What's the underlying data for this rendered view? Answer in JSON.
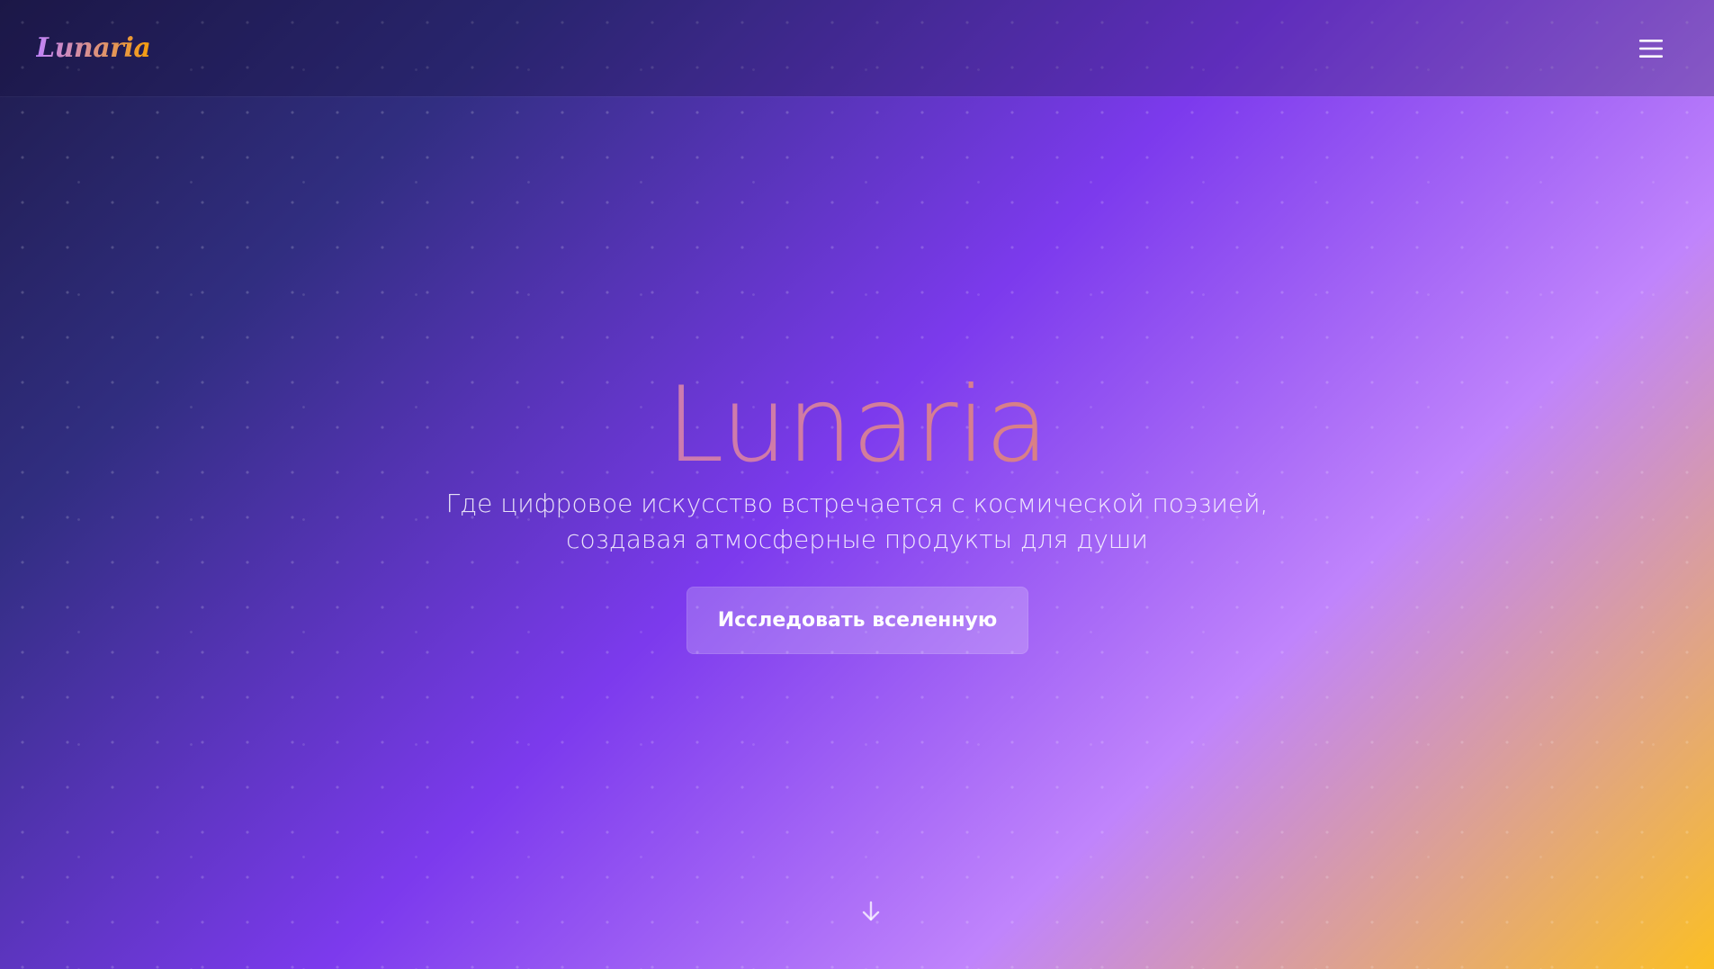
{
  "header": {
    "logo_text": "Lunaria",
    "menu_icon": "hamburger-menu-icon"
  },
  "hero": {
    "title": "Lunaria",
    "subtitle_line1": "Где цифровое искусство встречается с космической поэзией,",
    "subtitle_line2": "создавая атмосферные продукты для души",
    "cta_label": "Исследовать вселенную",
    "scroll_icon": "arrow-down-icon"
  },
  "colors": {
    "gradient_start": "#1e1b4b",
    "gradient_mid": "#7c3aed",
    "gradient_light": "#c084fc",
    "gradient_end": "#fbbf24",
    "title_gradient_start": "#b47fe0",
    "title_gradient_end": "#f08c2c"
  }
}
